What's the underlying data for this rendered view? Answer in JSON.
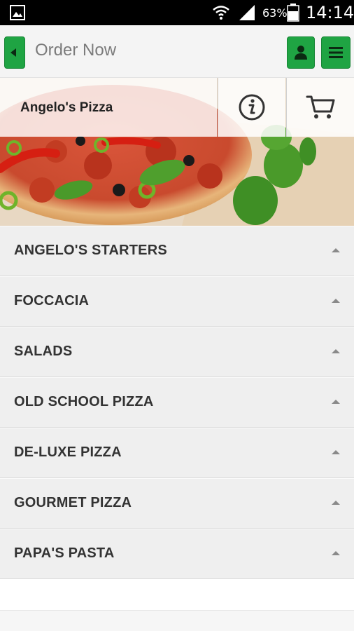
{
  "status_bar": {
    "battery_percent": "63%",
    "time": "14:14"
  },
  "header": {
    "title": "Order Now"
  },
  "hero": {
    "restaurant_name": "Angelo's Pizza"
  },
  "categories": [
    {
      "label": "ANGELO'S STARTERS"
    },
    {
      "label": "FOCCACIA"
    },
    {
      "label": "SALADS"
    },
    {
      "label": "OLD SCHOOL PIZZA"
    },
    {
      "label": "DE-LUXE PIZZA"
    },
    {
      "label": "GOURMET PIZZA"
    },
    {
      "label": "PAPA'S PASTA"
    }
  ],
  "colors": {
    "accent": "#1fa443",
    "category_bg": "#efefef"
  },
  "icons": {
    "back": "chevron-left-icon",
    "user": "user-icon",
    "menu": "hamburger-menu-icon",
    "info": "info-icon",
    "cart": "cart-icon",
    "expand": "caret-up-icon"
  }
}
